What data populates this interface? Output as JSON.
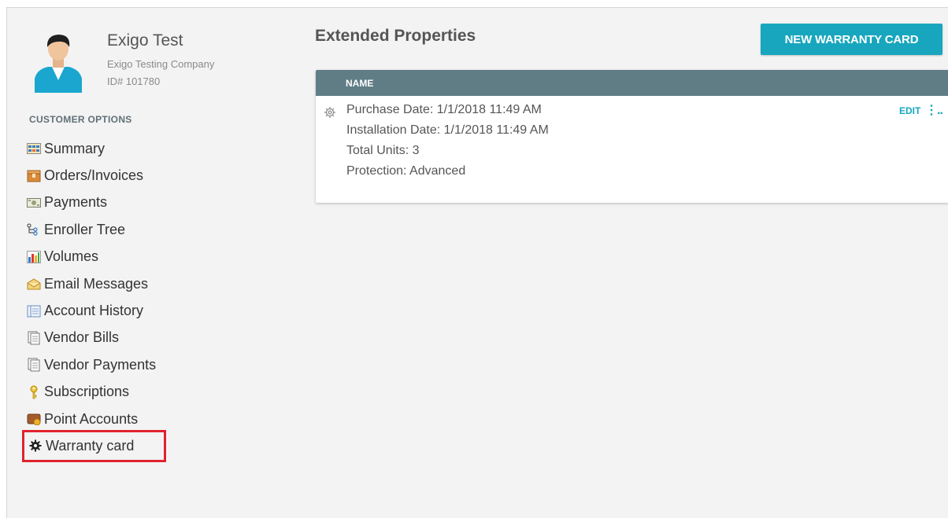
{
  "profile": {
    "name": "Exigo Test",
    "company": "Exigo Testing Company",
    "id": "ID# 101780"
  },
  "sidebar": {
    "section_title": "CUSTOMER OPTIONS",
    "items": [
      {
        "label": "Summary",
        "icon": "summary-icon"
      },
      {
        "label": "Orders/Invoices",
        "icon": "orders-icon"
      },
      {
        "label": "Payments",
        "icon": "payments-icon"
      },
      {
        "label": "Enroller Tree",
        "icon": "tree-icon"
      },
      {
        "label": "Volumes",
        "icon": "bar-chart-icon"
      },
      {
        "label": "Email Messages",
        "icon": "envelope-icon"
      },
      {
        "label": "Account History",
        "icon": "book-icon"
      },
      {
        "label": "Vendor Bills",
        "icon": "documents-icon"
      },
      {
        "label": "Vendor Payments",
        "icon": "documents-icon"
      },
      {
        "label": "Subscriptions",
        "icon": "key-icon"
      },
      {
        "label": "Point Accounts",
        "icon": "wallet-icon"
      },
      {
        "label": "Warranty card",
        "icon": "gear-icon"
      }
    ],
    "active_item": "Warranty card"
  },
  "main": {
    "title": "Extended Properties",
    "new_button": "NEW WARRANTY CARD",
    "table": {
      "column": "NAME",
      "row": {
        "lines": [
          "Purchase Date: 1/1/2018 11:49 AM",
          "Installation Date: 1/1/2018 11:49 AM",
          "Total Units: 3",
          "Protection: Advanced"
        ],
        "edit_label": "EDIT",
        "more_label": "⋮.."
      }
    }
  },
  "colors": {
    "accent": "#17a6bd",
    "table_header": "#607d86",
    "highlight": "#e0232e",
    "panel_bg": "#f3f3f3"
  }
}
